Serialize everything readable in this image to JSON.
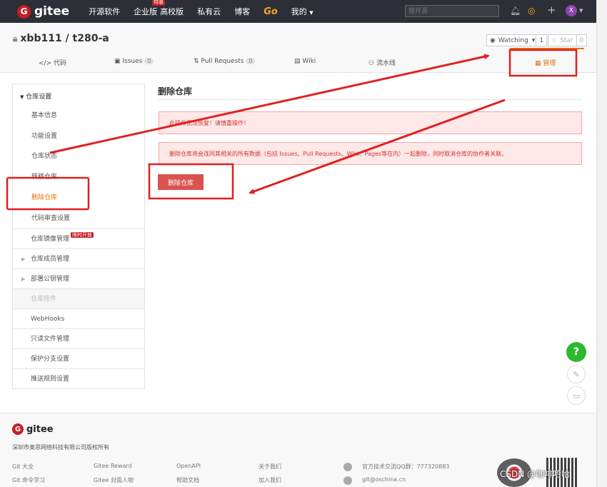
{
  "topnav": {
    "logo_text": "gitee",
    "items": [
      "开源软件",
      "企业版",
      "高校版",
      "私有云",
      "博客",
      "Go",
      "我的"
    ],
    "enterprise_badge": "特惠",
    "search_placeholder": "搜开源"
  },
  "avatar": {
    "letter": "X"
  },
  "repo": {
    "title": "xbb111 / t280-a",
    "watching_label": "Watching",
    "watching_count": "1",
    "star_label": "Star",
    "star_count": "0"
  },
  "tabs": [
    {
      "label": "代码"
    },
    {
      "label": "Issues",
      "count": "0"
    },
    {
      "label": "Pull Requests",
      "count": "0"
    },
    {
      "label": "Wiki"
    },
    {
      "label": "流水线"
    },
    {
      "label": "管理"
    }
  ],
  "sidebar": {
    "group_title": "仓库设置",
    "sub_items": [
      "基本信息",
      "功能设置",
      "仓库状态",
      "转移仓库",
      "删除仓库",
      "代码审查设置"
    ],
    "items": [
      "仓库镜像管理",
      "仓库成员管理",
      "部署公钥管理",
      "仓库挂件",
      "WebHooks",
      "只读文件管理",
      "保护分支设置",
      "推送规则设置"
    ],
    "mirror_badge": "限时开放"
  },
  "main": {
    "title": "删除仓库",
    "warning1": "此操作无法恢复！请慎重操作！",
    "warning2": "删除仓库将会连同其相关的所有数据（包括 Issues、Pull Requests、Wiki、Pages等在内）一起删除，同时取消仓库的协作者关联。",
    "delete_button": "删除仓库"
  },
  "footer": {
    "logo_text": "gitee",
    "copyright": "深圳市奥思网络科技有限公司版权所有",
    "links_row1": [
      "Git 大全",
      "Gitee Reward",
      "OpenAPI",
      "关于我们"
    ],
    "links_row2": [
      "Git 命令学习",
      "Gitee 封面人物",
      "帮助文档",
      "加入我们"
    ],
    "contact_qq": "官方技术交流QQ群：777320883",
    "contact_email": "git@oschina.cn"
  },
  "fab": {
    "help": "?"
  },
  "watermark": "CSDN @咖啡哈哈"
}
